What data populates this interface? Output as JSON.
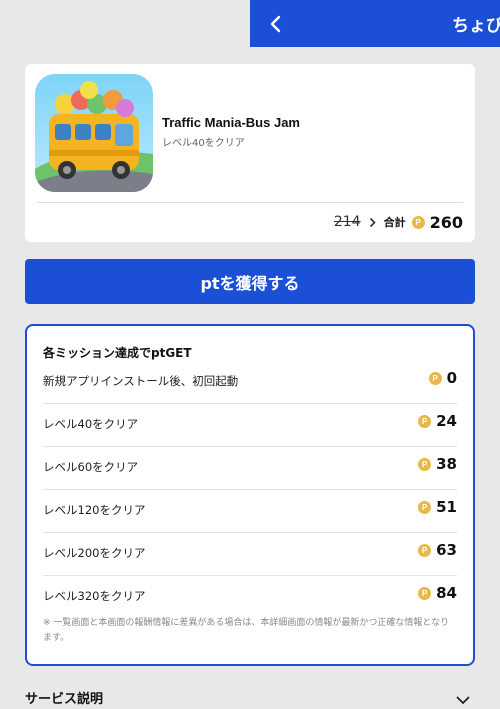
{
  "header": {
    "title": "ちょびリッチ",
    "back_icon": "chevron-left-icon"
  },
  "app": {
    "name": "Traffic Mania-Bus Jam",
    "subtitle": "レベル40をクリア",
    "old_points": "214",
    "total_label": "合計",
    "total_points": "260",
    "coin_glyph": "P"
  },
  "get_button": {
    "label": "ptを獲得する"
  },
  "missions": {
    "title": "各ミッション達成でptGET",
    "items": [
      {
        "label": "新規アプリインストール後、初回起動",
        "points": "0"
      },
      {
        "label": "レベル40をクリア",
        "points": "24"
      },
      {
        "label": "レベル60をクリア",
        "points": "38"
      },
      {
        "label": "レベル120をクリア",
        "points": "51"
      },
      {
        "label": "レベル200をクリア",
        "points": "63"
      },
      {
        "label": "レベル320をクリア",
        "points": "84"
      }
    ],
    "note": "※ 一覧画面と本画面の報酬情報に差異がある場合は、本詳細画面の情報が最新かつ正確な情報となります。"
  },
  "service": {
    "title": "サービス説明"
  },
  "colors": {
    "primary": "#1a4fd6",
    "coin": "#e8b94a",
    "background": "#e8e8e8"
  }
}
